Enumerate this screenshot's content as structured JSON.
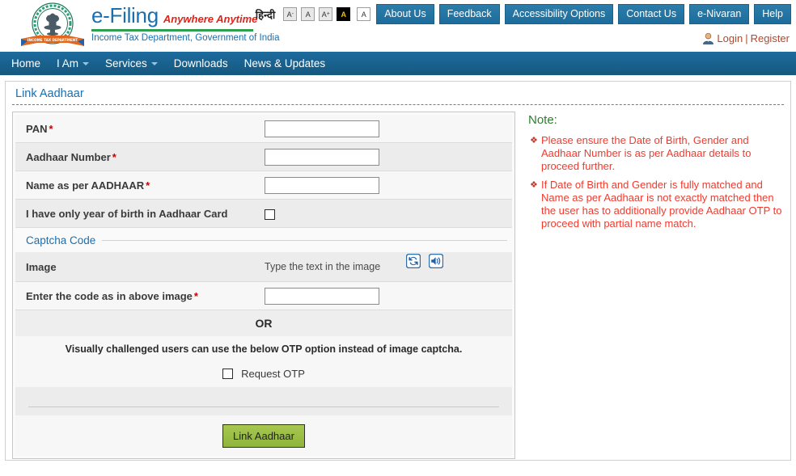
{
  "header": {
    "emblem_alt": "Government of India emblem with Income Tax Department ribbon",
    "brand_name": "e-Filing",
    "brand_tagline": "Anywhere Anytime",
    "brand_department": "Income Tax Department, Government of India",
    "hindi_label": "हिन्दी",
    "font_decrease": "A",
    "font_decrease_sup": "-",
    "font_normal": "A",
    "font_increase": "A",
    "font_increase_sup": "+",
    "contrast_dark": "A",
    "contrast_light": "A",
    "nav_buttons": [
      {
        "label": "About Us"
      },
      {
        "label": "Feedback"
      },
      {
        "label": "Accessibility Options"
      },
      {
        "label": "Contact Us"
      },
      {
        "label": "e-Nivaran"
      },
      {
        "label": "Help"
      }
    ],
    "login_label": "Login",
    "login_separator": "|",
    "register_label": "Register"
  },
  "mainnav": {
    "items": [
      {
        "label": "Home",
        "has_caret": false
      },
      {
        "label": "I Am",
        "has_caret": true
      },
      {
        "label": "Services",
        "has_caret": true
      },
      {
        "label": "Downloads",
        "has_caret": false
      },
      {
        "label": "News & Updates",
        "has_caret": false
      }
    ]
  },
  "page": {
    "title": "Link Aadhaar"
  },
  "form": {
    "pan_label": "PAN",
    "pan_required": "*",
    "pan_value": "",
    "aadhaar_label": "Aadhaar Number",
    "aadhaar_required": "*",
    "aadhaar_value": "",
    "name_label": "Name as per AADHAAR",
    "name_required": "*",
    "name_value": "",
    "year_only_label": "I have only year of birth in Aadhaar Card",
    "year_only_checked": false,
    "captcha_legend": "Captcha Code",
    "image_label": "Image",
    "captcha_hint": "Type the text in the image",
    "refresh_icon": "refresh-captcha-icon",
    "audio_icon": "audio-captcha-icon",
    "code_label": "Enter the code as in above image",
    "code_required": "*",
    "code_value": "",
    "or_label": "OR",
    "visually_challenged_text": "Visually challenged users can use the below OTP option instead of image captcha.",
    "request_otp_label": "Request OTP",
    "request_otp_checked": false,
    "submit_label": "Link Aadhaar"
  },
  "note": {
    "title": "Note:",
    "bullet_glyph": "❖",
    "items": [
      "Please ensure the Date of Birth, Gender and Aadhaar Number is as per Aadhaar details to proceed further.",
      "If Date of Birth and Gender is fully matched and Name as per Aadhaar is not exactly matched then the user has to additionally provide Aadhaar OTP to proceed with partial name match."
    ]
  },
  "colors": {
    "brand_blue": "#1a6faf",
    "nav_blue": "#1a6191",
    "tagline_red": "#e2231a",
    "green_rule": "#2e9e4f",
    "note_title_green": "#2e7d32",
    "note_text_red": "#f03a2e",
    "required_red": "#cc0000",
    "submit_green": "#8fb53c",
    "login_link": "#b5462a"
  }
}
